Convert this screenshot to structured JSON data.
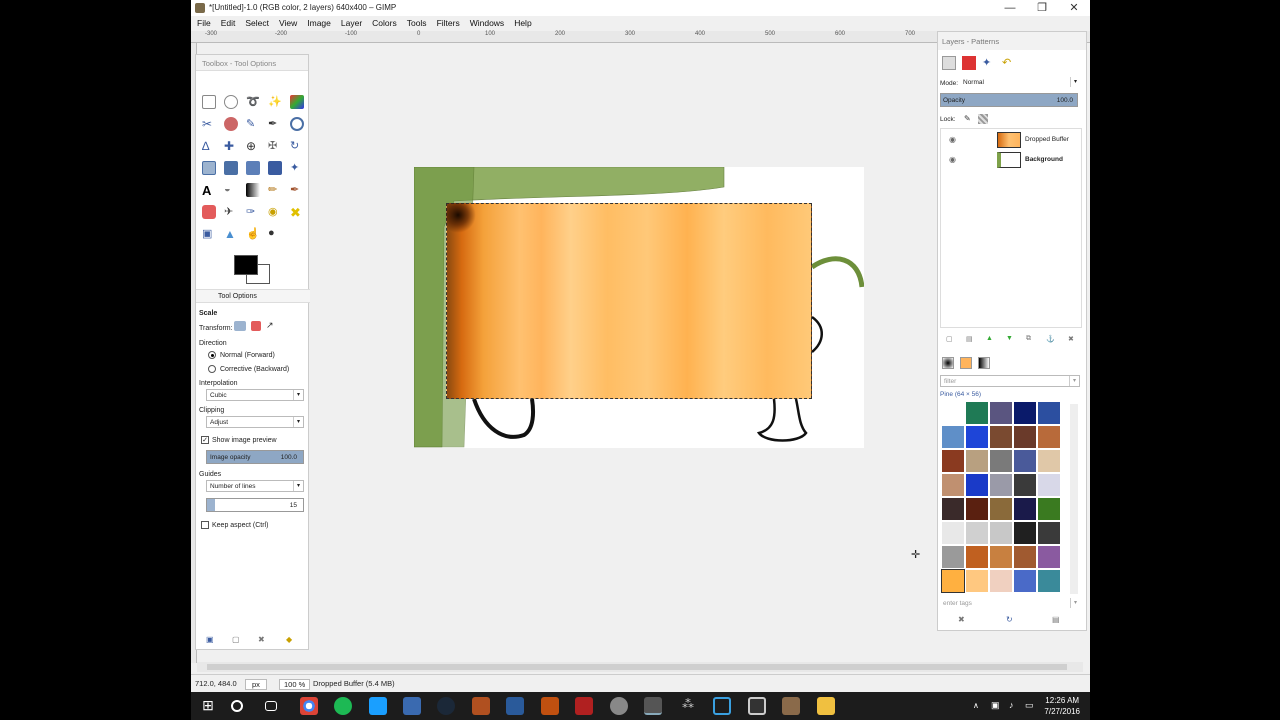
{
  "window": {
    "title": "*[Untitled]-1.0 (RGB color, 2 layers) 640x400 – GIMP",
    "minimize": "—",
    "restore": "❐",
    "close": "✕"
  },
  "menu": [
    "File",
    "Edit",
    "Select",
    "View",
    "Image",
    "Layer",
    "Colors",
    "Tools",
    "Filters",
    "Windows",
    "Help"
  ],
  "ruler_top": [
    "-300",
    "-200",
    "-100",
    "0",
    "100",
    "200",
    "300",
    "400",
    "500",
    "600",
    "700"
  ],
  "toolbox": {
    "header": "Toolbox - Tool Options",
    "tool_options_tab": "Tool Options",
    "tool_name": "Scale",
    "transform_label": "Transform:",
    "direction_label": "Direction",
    "direction_normal": "Normal (Forward)",
    "direction_corrective": "Corrective (Backward)",
    "interpolation_label": "Interpolation",
    "interpolation_value": "Cubic",
    "clipping_label": "Clipping",
    "clipping_value": "Adjust",
    "show_preview": "Show image preview",
    "image_opacity_label": "Image opacity",
    "image_opacity_value": "100.0",
    "guides_label": "Guides",
    "guides_value": "Number of lines",
    "lines_value": "15",
    "keep_aspect": "Keep aspect  (Ctrl)"
  },
  "dock": {
    "header": "Layers - Patterns",
    "mode_label": "Mode:",
    "mode_value": "Normal",
    "opacity_label": "Opacity",
    "opacity_value": "100.0",
    "lock_label": "Lock:",
    "layers": [
      {
        "name": "Dropped Buffer"
      },
      {
        "name": "Background"
      }
    ],
    "filter_placeholder": "filter",
    "pattern_name": "Pine (64 × 56)",
    "tags_placeholder": "enter tags"
  },
  "status": {
    "coords": "712.0, 484.0",
    "unit": "px",
    "zoom": "100 %",
    "message": "Dropped Buffer (5.4 MB)"
  },
  "taskbar": {
    "time": "12:26 AM",
    "date": "7/27/2016"
  },
  "colors": {
    "accent": "#8ea7c4",
    "buffer_orange": "#ffbd63",
    "taskbar": "#1c1c1c"
  }
}
